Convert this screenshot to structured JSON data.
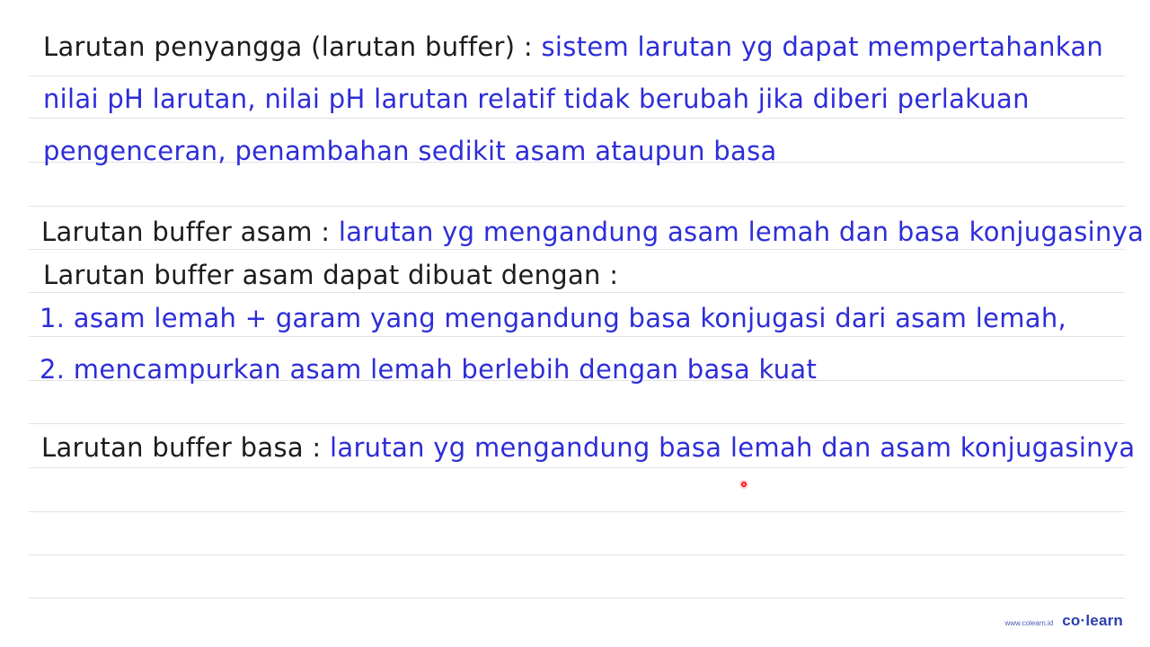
{
  "lines": [
    {
      "label": "Larutan penyangga (larutan buffer) :",
      "text": " sistem larutan yg dapat mempertahankan"
    },
    {
      "text": "nilai pH larutan, nilai pH larutan relatif tidak berubah jika diberi perlakuan"
    },
    {
      "text": "pengenceran, penambahan sedikit asam ataupun basa"
    },
    {
      "label": "Larutan buffer asam :",
      "text": " larutan yg mengandung asam lemah dan basa konjugasinya"
    },
    {
      "label": "Larutan buffer asam dapat dibuat dengan :"
    },
    {
      "text": "1. asam lemah + garam yang mengandung basa konjugasi dari asam lemah,"
    },
    {
      "text": "2. mencampurkan asam lemah berlebih dengan basa kuat"
    },
    {
      "label": "Larutan buffer basa :",
      "text": " larutan yg mengandung basa lemah dan asam konjugasinya"
    }
  ],
  "footer": {
    "url": "www.colearn.id",
    "logo": "co·learn"
  },
  "colors": {
    "label_text": "#1c1c1c",
    "content_text": "#2d2dd8",
    "pointer_dot": "#ff1a1a",
    "brand": "#2a3fb0"
  }
}
